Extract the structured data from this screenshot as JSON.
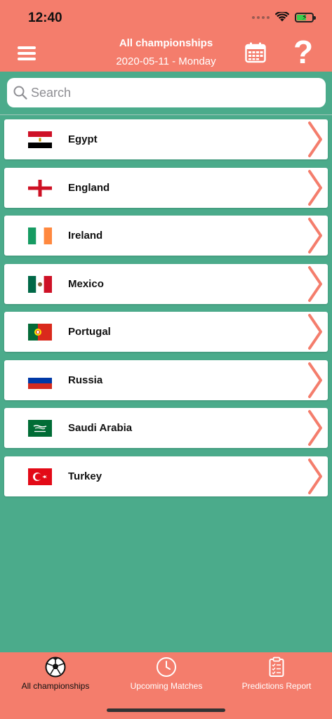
{
  "status": {
    "time": "12:40"
  },
  "header": {
    "title": "All championships",
    "date": "2020-05-11 - Monday",
    "help_label": "?"
  },
  "search": {
    "placeholder": "Search",
    "value": ""
  },
  "countries": [
    {
      "name": "Egypt",
      "flag": "egypt-flag"
    },
    {
      "name": "England",
      "flag": "england-flag"
    },
    {
      "name": "Ireland",
      "flag": "ireland-flag"
    },
    {
      "name": "Mexico",
      "flag": "mexico-flag"
    },
    {
      "name": "Portugal",
      "flag": "portugal-flag"
    },
    {
      "name": "Russia",
      "flag": "russia-flag"
    },
    {
      "name": "Saudi Arabia",
      "flag": "saudi-arabia-flag"
    },
    {
      "name": "Turkey",
      "flag": "turkey-flag"
    }
  ],
  "tabs": [
    {
      "label": "All championships",
      "icon": "soccer-ball-icon",
      "active": true
    },
    {
      "label": "Upcoming Matches",
      "icon": "clock-icon",
      "active": false
    },
    {
      "label": "Predictions Report",
      "icon": "clipboard-icon",
      "active": false
    }
  ],
  "colors": {
    "header": "#f47d6c",
    "background": "#4bab8b",
    "accent": "#f47d6c",
    "battery": "#3ccd4c"
  }
}
